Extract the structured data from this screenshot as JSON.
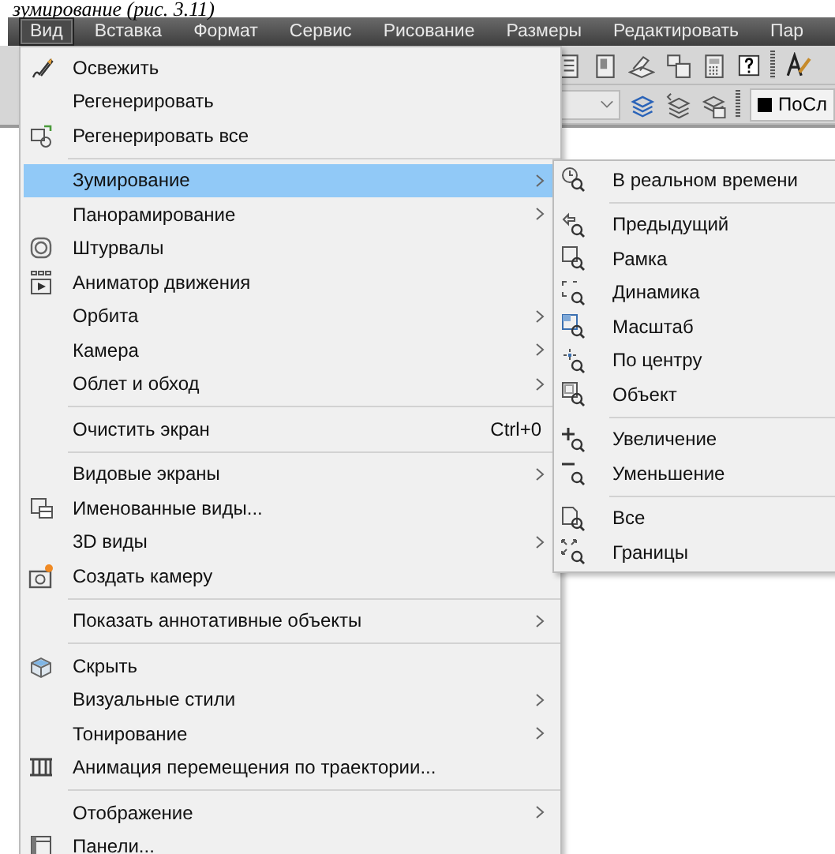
{
  "caption": "зумирование (рис. 3.11)",
  "menubar": [
    {
      "label": "Вид",
      "selected": true
    },
    {
      "label": "Вставка",
      "selected": false
    },
    {
      "label": "Формат",
      "selected": false
    },
    {
      "label": "Сервис",
      "selected": false
    },
    {
      "label": "Рисование",
      "selected": false
    },
    {
      "label": "Размеры",
      "selected": false
    },
    {
      "label": "Редактировать",
      "selected": false
    },
    {
      "label": "Пар",
      "selected": false
    }
  ],
  "toolbar": {
    "layer_value": "ПоСл"
  },
  "menu": {
    "items": [
      {
        "kind": "item",
        "label": "Освежить",
        "has_icon": true,
        "submenu": false,
        "selected": false
      },
      {
        "kind": "item",
        "label": "Регенерировать",
        "has_icon": false,
        "submenu": false,
        "selected": false
      },
      {
        "kind": "item",
        "label": "Регенерировать все",
        "has_icon": true,
        "submenu": false,
        "selected": false
      },
      {
        "kind": "separator"
      },
      {
        "kind": "item",
        "label": "Зумирование",
        "has_icon": false,
        "submenu": true,
        "selected": true
      },
      {
        "kind": "item",
        "label": "Панорамирование",
        "has_icon": false,
        "submenu": true,
        "selected": false
      },
      {
        "kind": "item",
        "label": "Штурвалы",
        "has_icon": true,
        "submenu": false,
        "selected": false
      },
      {
        "kind": "item",
        "label": "Аниматор движения",
        "has_icon": true,
        "submenu": false,
        "selected": false
      },
      {
        "kind": "item",
        "label": "Орбита",
        "has_icon": false,
        "submenu": true,
        "selected": false
      },
      {
        "kind": "item",
        "label": "Камера",
        "has_icon": false,
        "submenu": true,
        "selected": false
      },
      {
        "kind": "item",
        "label": "Облет и обход",
        "has_icon": false,
        "submenu": true,
        "selected": false
      },
      {
        "kind": "separator"
      },
      {
        "kind": "item",
        "label": "Очистить экран",
        "has_icon": false,
        "submenu": false,
        "selected": false,
        "shortcut": "Ctrl+0"
      },
      {
        "kind": "separator"
      },
      {
        "kind": "item",
        "label": "Видовые экраны",
        "has_icon": false,
        "submenu": true,
        "selected": false
      },
      {
        "kind": "item",
        "label": "Именованные виды...",
        "has_icon": true,
        "submenu": false,
        "selected": false
      },
      {
        "kind": "item",
        "label": "3D виды",
        "has_icon": false,
        "submenu": true,
        "selected": false
      },
      {
        "kind": "item",
        "label": "Создать камеру",
        "has_icon": true,
        "submenu": false,
        "selected": false
      },
      {
        "kind": "separator"
      },
      {
        "kind": "item",
        "label": "Показать аннотативные объекты",
        "has_icon": false,
        "submenu": true,
        "selected": false
      },
      {
        "kind": "separator"
      },
      {
        "kind": "item",
        "label": "Скрыть",
        "has_icon": true,
        "submenu": false,
        "selected": false
      },
      {
        "kind": "item",
        "label": "Визуальные стили",
        "has_icon": false,
        "submenu": true,
        "selected": false
      },
      {
        "kind": "item",
        "label": "Тонирование",
        "has_icon": false,
        "submenu": true,
        "selected": false
      },
      {
        "kind": "item",
        "label": "Анимация перемещения по траектории...",
        "has_icon": true,
        "submenu": false,
        "selected": false
      },
      {
        "kind": "separator"
      },
      {
        "kind": "item",
        "label": "Отображение",
        "has_icon": false,
        "submenu": true,
        "selected": false
      },
      {
        "kind": "item",
        "label": "Панели...",
        "has_icon": true,
        "submenu": false,
        "selected": false
      }
    ]
  },
  "submenu": {
    "items": [
      {
        "kind": "item",
        "label": "В реальном времени",
        "selected": false
      },
      {
        "kind": "separator"
      },
      {
        "kind": "item",
        "label": "Предыдущий",
        "selected": false
      },
      {
        "kind": "item",
        "label": "Рамка",
        "selected": false
      },
      {
        "kind": "item",
        "label": "Динамика",
        "selected": false
      },
      {
        "kind": "item",
        "label": "Масштаб",
        "selected": false
      },
      {
        "kind": "item",
        "label": "По центру",
        "selected": false
      },
      {
        "kind": "item",
        "label": "Объект",
        "selected": false
      },
      {
        "kind": "separator"
      },
      {
        "kind": "item",
        "label": "Увеличение",
        "selected": false
      },
      {
        "kind": "item",
        "label": "Уменьшение",
        "selected": false
      },
      {
        "kind": "separator"
      },
      {
        "kind": "item",
        "label": "Все",
        "selected": false
      },
      {
        "kind": "item",
        "label": "Границы",
        "selected": false
      }
    ]
  }
}
